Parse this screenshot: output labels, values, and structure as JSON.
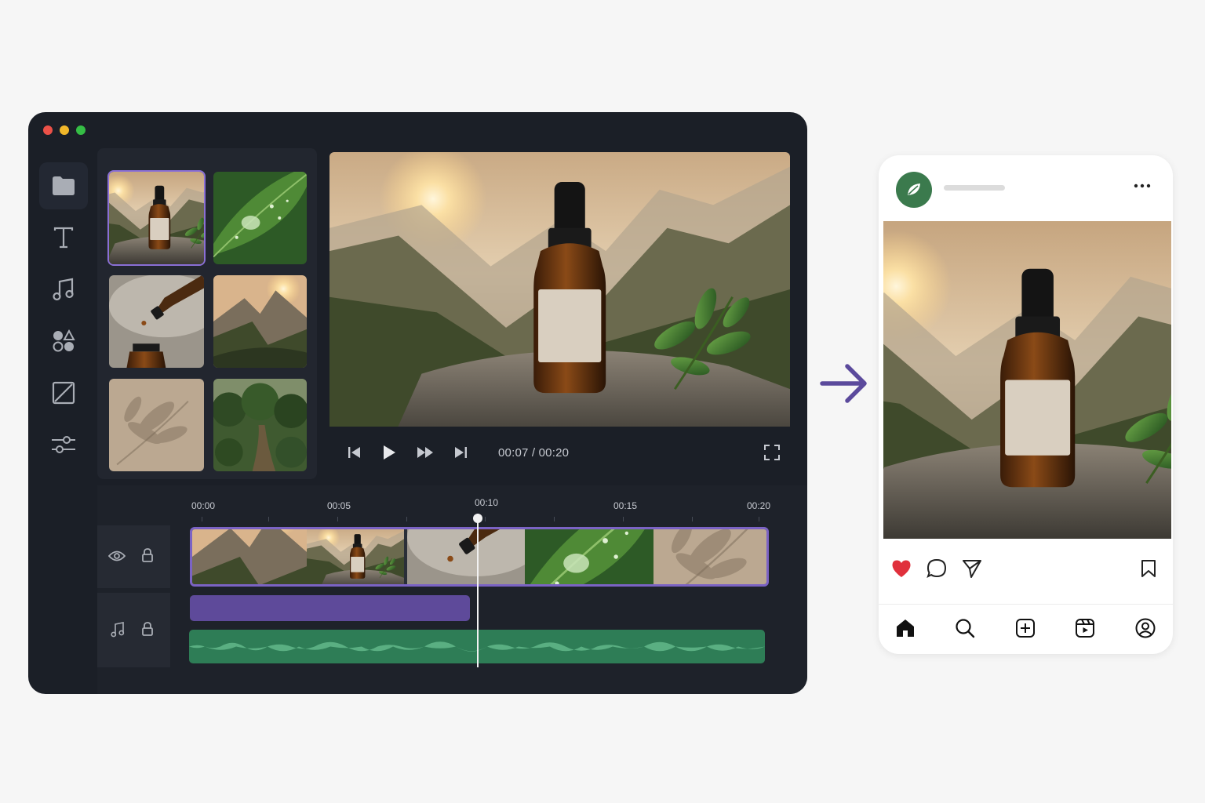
{
  "editor": {
    "window_controls": [
      "close",
      "minimize",
      "maximize"
    ],
    "sidebar": {
      "items": [
        {
          "icon": "folder-icon",
          "active": true
        },
        {
          "icon": "text-icon",
          "active": false
        },
        {
          "icon": "music-icon",
          "active": false
        },
        {
          "icon": "shapes-icon",
          "active": false
        },
        {
          "icon": "crop-icon",
          "active": false
        },
        {
          "icon": "adjust-sliders-icon",
          "active": false
        }
      ]
    },
    "media": {
      "thumbnails": [
        {
          "scene": "bottle-mountains",
          "selected": true
        },
        {
          "scene": "leaf-droplet",
          "selected": false
        },
        {
          "scene": "dropper",
          "selected": false
        },
        {
          "scene": "mountain-valley",
          "selected": false
        },
        {
          "scene": "leaf-shadow",
          "selected": false
        },
        {
          "scene": "forest-path",
          "selected": false
        }
      ]
    },
    "player": {
      "timecode": "00:07 / 00:20",
      "controls": [
        "skip-back-icon",
        "play-icon",
        "fast-forward-icon",
        "skip-forward-icon",
        "fullscreen-icon"
      ]
    },
    "timeline": {
      "ruler": [
        "00:00",
        "00:05",
        "00:10",
        "00:15",
        "00:20"
      ],
      "playhead_time": "00:10",
      "tracks": [
        {
          "type": "video",
          "icons": [
            "eye-icon",
            "lock-icon"
          ]
        },
        {
          "type": "audio",
          "icons": [
            "music-note-icon",
            "lock-icon"
          ]
        }
      ]
    }
  },
  "colors": {
    "accent": "#7b63c4",
    "audio_bar": "#5e4a9a",
    "waveform": "#2e7d56",
    "avatar": "#3b7a4d",
    "like": "#e0303c"
  },
  "post": {
    "menu_icon": "more-dots-icon",
    "actions": [
      "heart-icon",
      "comment-icon",
      "share-icon",
      "bookmark-icon"
    ],
    "nav": [
      "home-icon",
      "search-icon",
      "add-icon",
      "reels-icon",
      "profile-icon"
    ]
  }
}
